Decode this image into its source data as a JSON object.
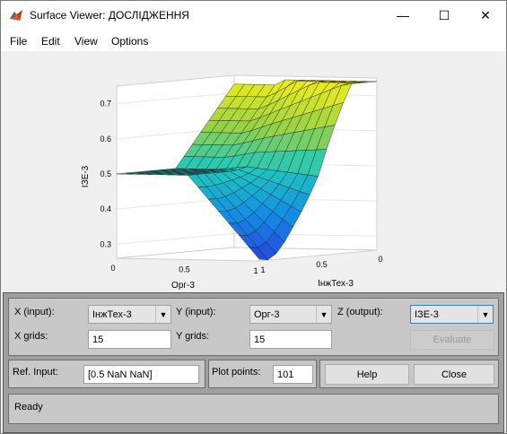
{
  "window": {
    "title": "Surface Viewer: ДОСЛІДЖЕННЯ",
    "controls": {
      "minimize": "—",
      "maximize": "☐",
      "close": "✕"
    }
  },
  "menu": [
    "File",
    "Edit",
    "View",
    "Options"
  ],
  "chart_data": {
    "type": "surface",
    "zlabel": "ІЗЕ-3",
    "xlabel": "Орг-3",
    "ylabel": "ІнжТех-3",
    "z_ticks": [
      "0.3",
      "0.4",
      "0.5",
      "0.6",
      "0.7"
    ],
    "x_ticks": [
      "0",
      "0.5",
      "1"
    ],
    "y_ticks": [
      "1",
      "0.5",
      "0"
    ],
    "zlim": [
      0.26,
      0.75
    ],
    "colormap": "parula",
    "grid": true
  },
  "controls": {
    "x_input_label": "X (input):",
    "x_input_value": "ІнжТех-3",
    "y_input_label": "Y (input):",
    "y_input_value": "Орг-3",
    "z_output_label": "Z (output):",
    "z_output_value": "ІЗЕ-3",
    "x_grids_label": "X grids:",
    "x_grids_value": "15",
    "y_grids_label": "Y grids:",
    "y_grids_value": "15",
    "evaluate_label": "Evaluate",
    "ref_input_label": "Ref. Input:",
    "ref_input_value": "[0.5 NaN NaN]",
    "plot_points_label": "Plot points:",
    "plot_points_value": "101",
    "help_label": "Help",
    "close_label": "Close",
    "status": "Ready"
  }
}
